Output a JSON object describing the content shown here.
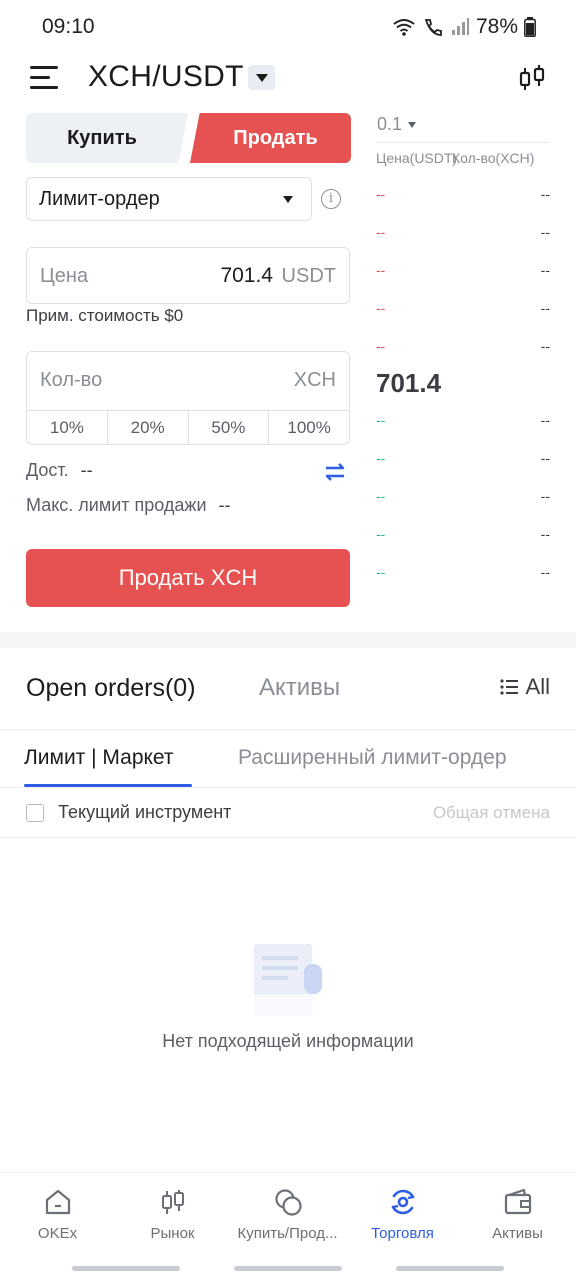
{
  "status_bar": {
    "time": "09:10",
    "battery": "78%"
  },
  "header": {
    "pair": "XCH/USDT",
    "icons": [
      "menu-icon",
      "chevron-down-icon",
      "candlestick-chart-icon"
    ]
  },
  "trade_form": {
    "buy_label": "Купить",
    "sell_label": "Продать",
    "order_type": "Лимит-ордер",
    "price_placeholder": "Цена",
    "price_value": "701.4",
    "price_unit": "USDT",
    "approx_cost": "Прим. стоимость $0",
    "qty_placeholder": "Кол-во",
    "qty_unit": "XCH",
    "percentages": [
      "10%",
      "20%",
      "50%",
      "100%"
    ],
    "available_label": "Дост.",
    "available_value": "--",
    "max_limit_label": "Макс. лимит продажи",
    "max_limit_value": "--",
    "submit_label": "Продать XCH"
  },
  "order_book": {
    "depth": "0.1",
    "price_header": "Цена(USDT)",
    "qty_header": "Кол-во(XCH)",
    "asks": [
      [
        "--",
        "--"
      ],
      [
        "--",
        "--"
      ],
      [
        "--",
        "--"
      ],
      [
        "--",
        "--"
      ],
      [
        "--",
        "--"
      ]
    ],
    "mid_price": "701.4",
    "bids": [
      [
        "--",
        "--"
      ],
      [
        "--",
        "--"
      ],
      [
        "--",
        "--"
      ],
      [
        "--",
        "--"
      ],
      [
        "--",
        "--"
      ]
    ],
    "ask_color": "#e65251",
    "bid_color": "#1fb99b"
  },
  "orders": {
    "tab_open": "Open orders(0)",
    "tab_assets": "Активы",
    "all_label": "All",
    "sub_tab_limit": "Лимит | Маркет",
    "sub_tab_advanced": "Расширенный лимит-ордер",
    "current_instrument": "Текущий инструмент",
    "cancel_all": "Общая отмена",
    "empty_text": "Нет подходящей информации"
  },
  "bottom_nav": [
    {
      "label": "OKEx",
      "icon": "home-icon",
      "active": false
    },
    {
      "label": "Рынок",
      "icon": "candlestick-icon",
      "active": false
    },
    {
      "label": "Купить/Прод...",
      "icon": "coins-icon",
      "active": false
    },
    {
      "label": "Торговля",
      "icon": "trade-icon",
      "active": true
    },
    {
      "label": "Активы",
      "icon": "wallet-icon",
      "active": false
    }
  ],
  "colors": {
    "accent": "#2e5ee5",
    "sell": "#e65251",
    "buy": "#1fb99b"
  }
}
